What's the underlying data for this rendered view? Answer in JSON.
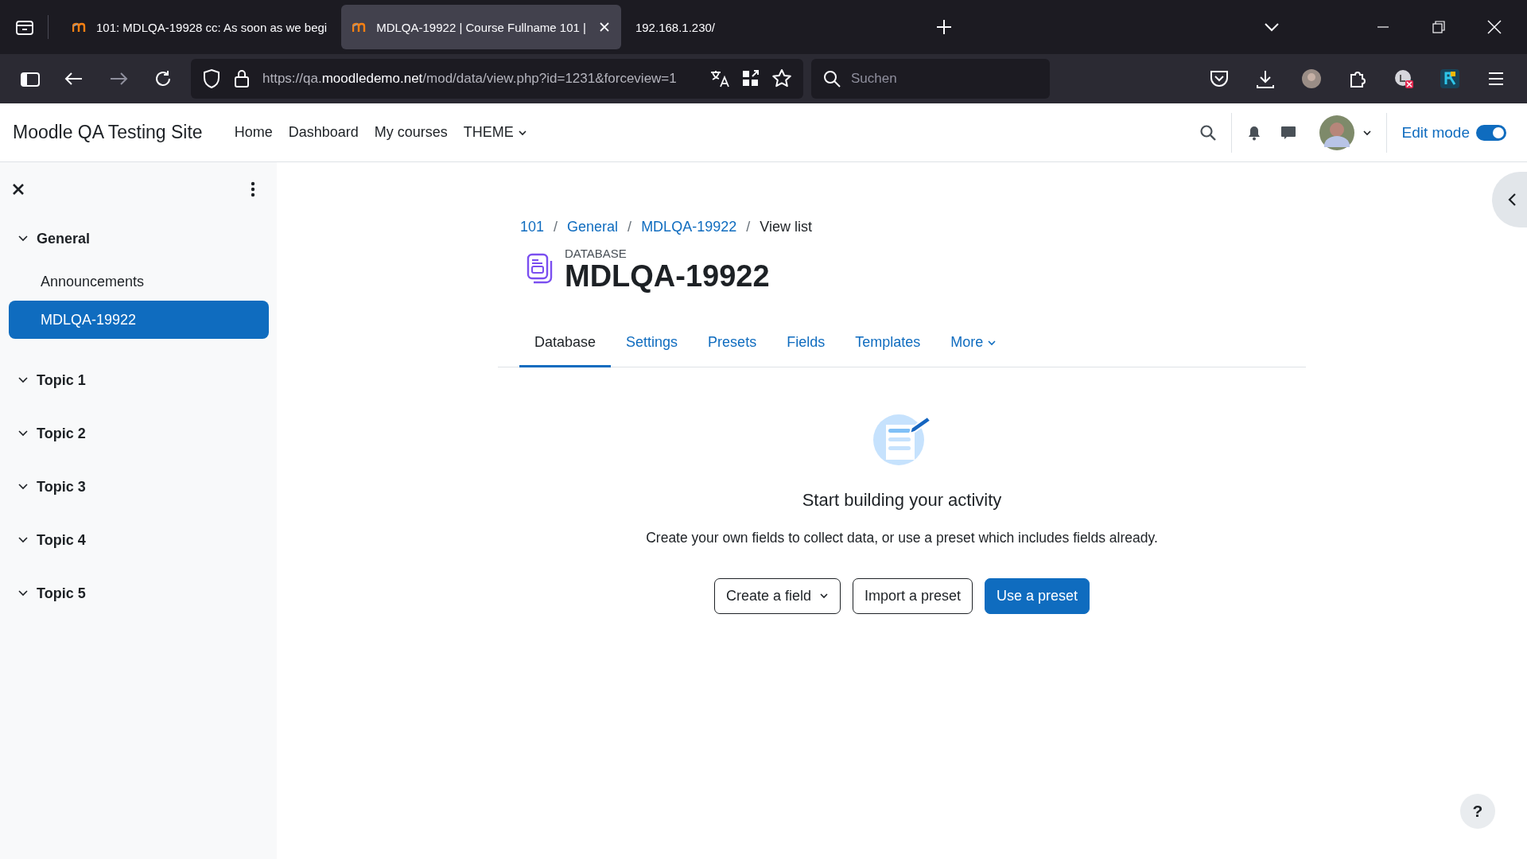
{
  "browser": {
    "tabs": [
      {
        "title": "101: MDLQA-19928 cc: As soon as we begi",
        "selected": false,
        "favicon": true,
        "closable": false
      },
      {
        "title": "MDLQA-19922 | Course Fullname 101 |",
        "selected": true,
        "favicon": true,
        "closable": true
      },
      {
        "title": "192.168.1.230/",
        "selected": false,
        "favicon": false,
        "closable": false
      }
    ],
    "url_parts": [
      {
        "text": "https://qa.",
        "highlight": false
      },
      {
        "text": "moodledemo.net",
        "highlight": true
      },
      {
        "text": "/mod/data/view.php?id=1231&forceview=1",
        "highlight": false
      }
    ],
    "search": {
      "placeholder": "Suchen"
    }
  },
  "header": {
    "site_name": "Moodle QA Testing Site",
    "nav": [
      {
        "label": "Home",
        "has_menu": false
      },
      {
        "label": "Dashboard",
        "has_menu": false
      },
      {
        "label": "My courses",
        "has_menu": false
      },
      {
        "label": "THEME",
        "has_menu": true
      }
    ],
    "edit_mode": {
      "label": "Edit mode",
      "on": true
    }
  },
  "course_index": {
    "sections": [
      {
        "title": "General",
        "expanded": true,
        "children": [
          {
            "label": "Announcements",
            "selected": false
          },
          {
            "label": "MDLQA-19922",
            "selected": true
          }
        ]
      },
      {
        "title": "Topic 1",
        "expanded": true
      },
      {
        "title": "Topic 2",
        "expanded": true
      },
      {
        "title": "Topic 3",
        "expanded": true
      },
      {
        "title": "Topic 4",
        "expanded": true
      },
      {
        "title": "Topic 5",
        "expanded": true
      }
    ]
  },
  "breadcrumb": [
    {
      "text": "101",
      "kind": "link"
    },
    {
      "text": "/",
      "kind": "separator"
    },
    {
      "text": "General",
      "kind": "link"
    },
    {
      "text": "/",
      "kind": "separator"
    },
    {
      "text": "MDLQA-19922",
      "kind": "link"
    },
    {
      "text": "/",
      "kind": "separator"
    },
    {
      "text": "View list",
      "kind": "current"
    }
  ],
  "activity": {
    "type": "DATABASE",
    "title": "MDLQA-19922"
  },
  "tabs": [
    {
      "label": "Database",
      "selected": true,
      "has_menu": false
    },
    {
      "label": "Settings",
      "selected": false,
      "has_menu": false
    },
    {
      "label": "Presets",
      "selected": false,
      "has_menu": false
    },
    {
      "label": "Fields",
      "selected": false,
      "has_menu": false
    },
    {
      "label": "Templates",
      "selected": false,
      "has_menu": false
    },
    {
      "label": "More",
      "selected": false,
      "has_menu": true
    }
  ],
  "empty_state": {
    "title": "Start building your activity",
    "text": "Create your own fields to collect data, or use a preset which includes fields already.",
    "buttons": [
      {
        "label": "Create a field",
        "kind": "dropdown"
      },
      {
        "label": "Import a preset",
        "kind": "secondary"
      },
      {
        "label": "Use a preset",
        "kind": "primary"
      }
    ]
  },
  "help_button": "?"
}
